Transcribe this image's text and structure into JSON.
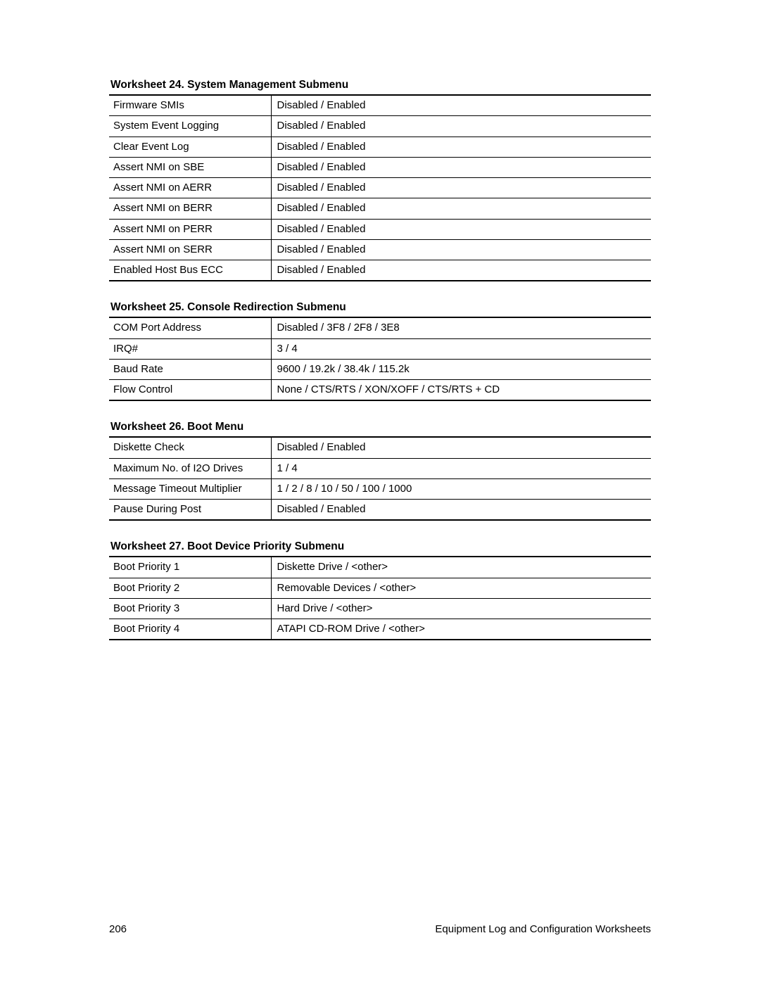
{
  "worksheets": [
    {
      "title": "Worksheet 24.  System Management Submenu",
      "rows": [
        {
          "label": "Firmware SMIs",
          "value": "Disabled  /  Enabled"
        },
        {
          "label": "System Event Logging",
          "value": "Disabled  /  Enabled"
        },
        {
          "label": "Clear Event Log",
          "value": "Disabled  /  Enabled"
        },
        {
          "label": "Assert NMI on SBE",
          "value": "Disabled  /  Enabled"
        },
        {
          "label": "Assert NMI on AERR",
          "value": "Disabled  /  Enabled"
        },
        {
          "label": "Assert NMI on BERR",
          "value": "Disabled  /  Enabled"
        },
        {
          "label": "Assert NMI on PERR",
          "value": "Disabled  /  Enabled"
        },
        {
          "label": "Assert NMI on SERR",
          "value": "Disabled  /  Enabled"
        },
        {
          "label": "Enabled Host Bus ECC",
          "value": "Disabled  /  Enabled"
        }
      ]
    },
    {
      "title": "Worksheet 25.  Console Redirection Submenu",
      "rows": [
        {
          "label": "COM Port Address",
          "value": "Disabled  /  3F8  /  2F8  /  3E8"
        },
        {
          "label": "IRQ#",
          "value": "3  /  4"
        },
        {
          "label": "Baud Rate",
          "value": "9600  /  19.2k  /  38.4k  /  115.2k"
        },
        {
          "label": "Flow Control",
          "value": "None  /  CTS/RTS  /  XON/XOFF  /  CTS/RTS + CD"
        }
      ]
    },
    {
      "title": "Worksheet 26.  Boot Menu",
      "rows": [
        {
          "label": "Diskette Check",
          "value": "Disabled  /  Enabled"
        },
        {
          "label": "Maximum No. of I2O Drives",
          "value": " 1  /  4"
        },
        {
          "label": "Message Timeout Multiplier",
          "value": " 1  /  2  /  8  /  10  /  50  /  100  /  1000"
        },
        {
          "label": "Pause During Post",
          "value": "Disabled  /  Enabled"
        }
      ]
    },
    {
      "title": "Worksheet 27.  Boot Device Priority Submenu",
      "rows": [
        {
          "label": "Boot Priority 1",
          "value": "Diskette Drive  /  <other>"
        },
        {
          "label": "Boot Priority 2",
          "value": "Removable Devices  /  <other>"
        },
        {
          "label": "Boot Priority 3",
          "value": "Hard Drive  /  <other>"
        },
        {
          "label": "Boot Priority 4",
          "value": "ATAPI CD-ROM Drive  /  <other>"
        }
      ]
    }
  ],
  "footer": {
    "page_number": "206",
    "section_title": "Equipment Log and Configuration Worksheets"
  }
}
